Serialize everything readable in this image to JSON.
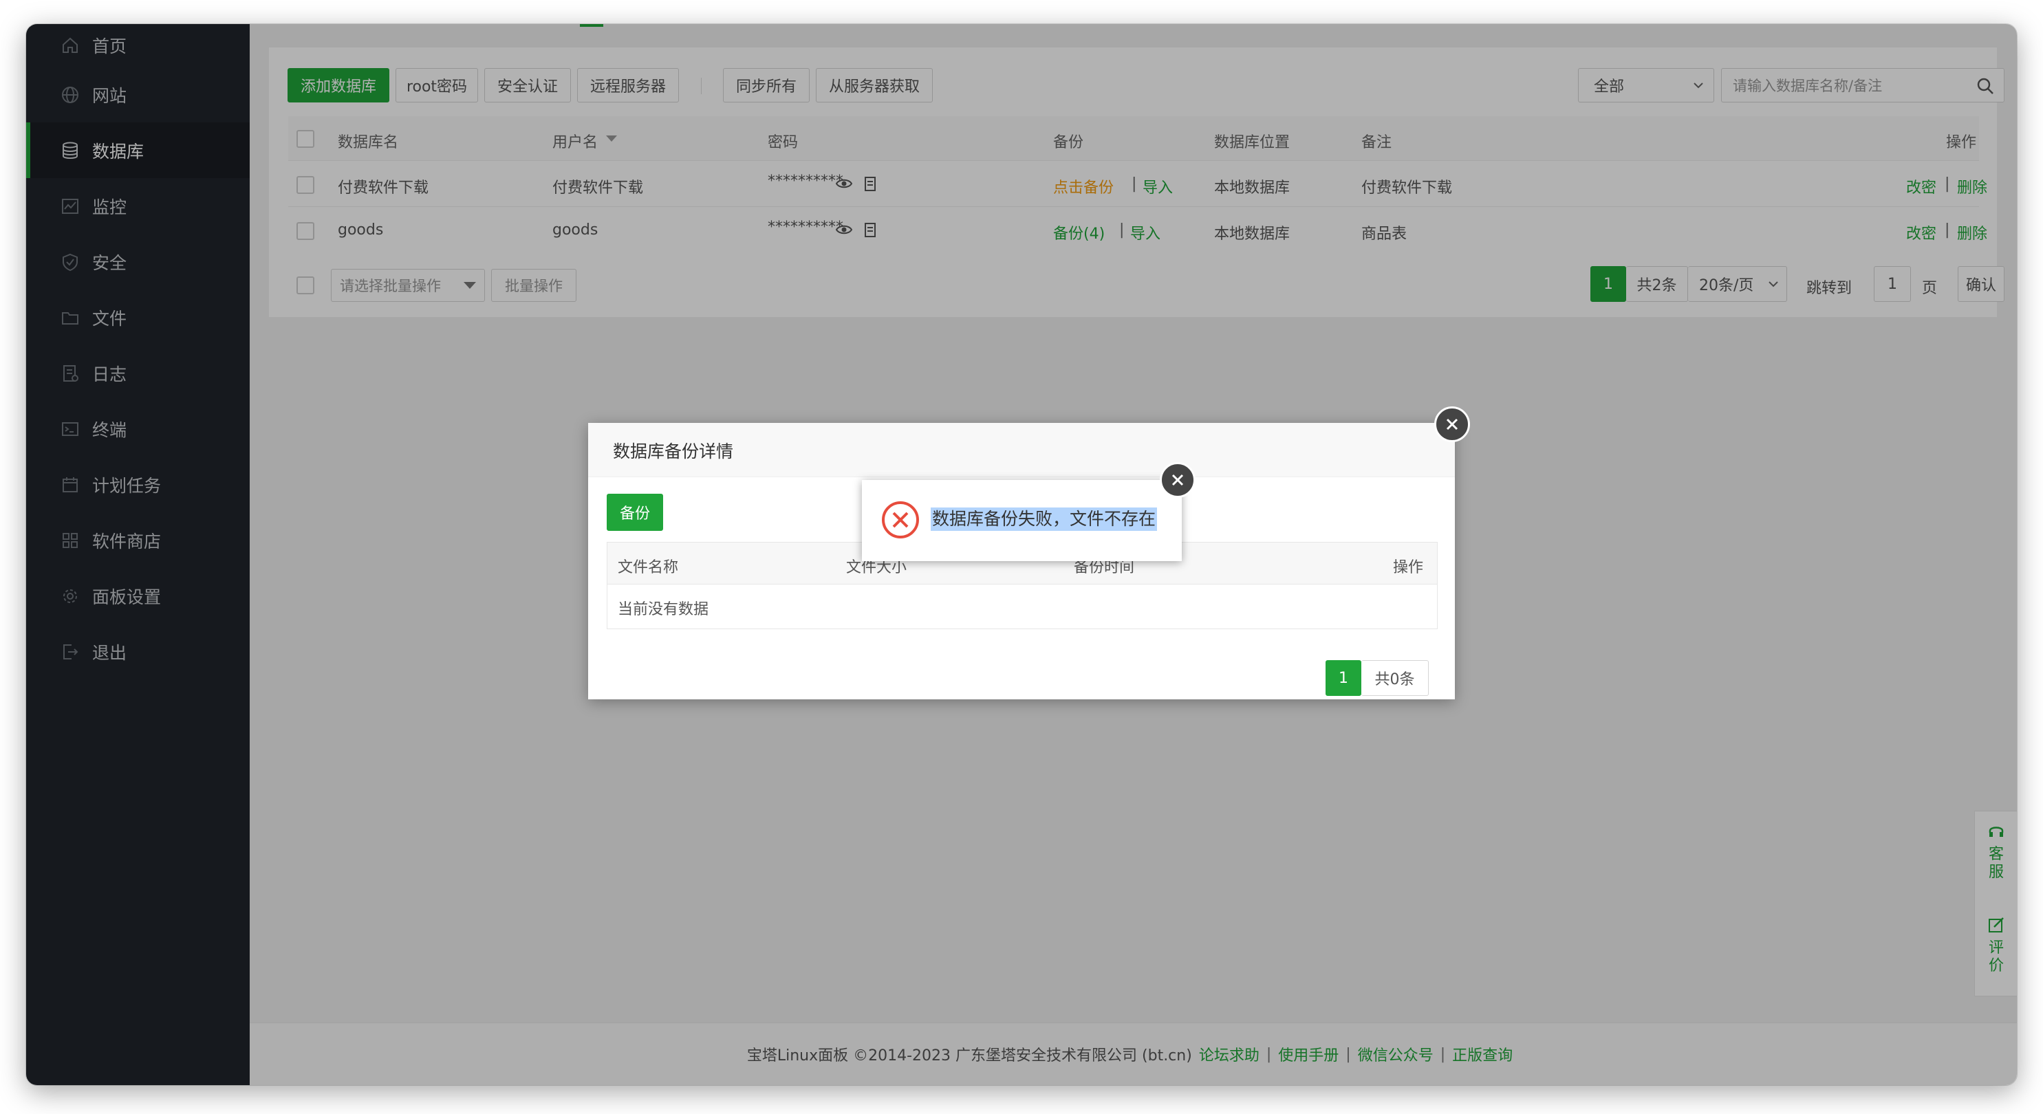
{
  "sidebar": {
    "items": [
      {
        "label": "首页",
        "icon": "home-icon"
      },
      {
        "label": "网站",
        "icon": "globe-icon"
      },
      {
        "label": "数据库",
        "icon": "database-icon",
        "active": true
      },
      {
        "label": "监控",
        "icon": "monitor-icon"
      },
      {
        "label": "安全",
        "icon": "shield-icon"
      },
      {
        "label": "文件",
        "icon": "folder-icon"
      },
      {
        "label": "日志",
        "icon": "log-icon"
      },
      {
        "label": "终端",
        "icon": "terminal-icon"
      },
      {
        "label": "计划任务",
        "icon": "calendar-icon"
      },
      {
        "label": "软件商店",
        "icon": "grid-icon"
      },
      {
        "label": "面板设置",
        "icon": "gear-icon"
      },
      {
        "label": "退出",
        "icon": "logout-icon"
      }
    ]
  },
  "toolbar": {
    "add_db": "添加数据库",
    "root_password": "root密码",
    "security_auth": "安全认证",
    "remote_server": "远程服务器",
    "sync_all": "同步所有",
    "fetch_from_server": "从服务器获取",
    "filter_selected": "全部",
    "search_placeholder": "请输入数据库名称/备注"
  },
  "table": {
    "headers": {
      "name": "数据库名",
      "username": "用户名",
      "password": "密码",
      "backup": "备份",
      "location": "数据库位置",
      "note": "备注",
      "actions": "操作"
    },
    "rows": [
      {
        "name": "付费软件下载",
        "username": "付费软件下载",
        "password": "**********",
        "backup_link": "点击备份",
        "import": "导入",
        "location": "本地数据库",
        "note": "付费软件下载",
        "change_pw": "改密",
        "delete": "删除"
      },
      {
        "name": "goods",
        "username": "goods",
        "password": "**********",
        "backup_link": "备份(4)",
        "import": "导入",
        "location": "本地数据库",
        "note": "商品表",
        "change_pw": "改密",
        "delete": "删除"
      }
    ],
    "sep": "|"
  },
  "bulk": {
    "select_placeholder": "请选择批量操作",
    "apply": "批量操作"
  },
  "pagination": {
    "current": "1",
    "total": "共2条",
    "per_page": "20条/页",
    "jump_label": "跳转到",
    "jump_value": "1",
    "page_unit": "页",
    "confirm": "确认"
  },
  "footer": {
    "copyright": "宝塔Linux面板 ©2014-2023 广东堡塔安全技术有限公司 (bt.cn)",
    "links": [
      "论坛求助",
      "使用手册",
      "微信公众号",
      "正版查询"
    ],
    "sep": "|"
  },
  "dialog": {
    "title": "数据库备份详情",
    "backup_button": "备份",
    "headers": {
      "filename": "文件名称",
      "size": "文件大小",
      "time": "备份时间",
      "actions": "操作"
    },
    "empty": "当前没有数据",
    "page": "1",
    "total": "共0条"
  },
  "toast": {
    "message": "数据库备份失败，文件不存在"
  },
  "side_widget": {
    "support": "客服",
    "review": "评价"
  },
  "colors": {
    "accent": "#20a53a",
    "sidebar_bg": "#20252b",
    "error": "#e74c3c",
    "warning_link": "#f39c12"
  }
}
